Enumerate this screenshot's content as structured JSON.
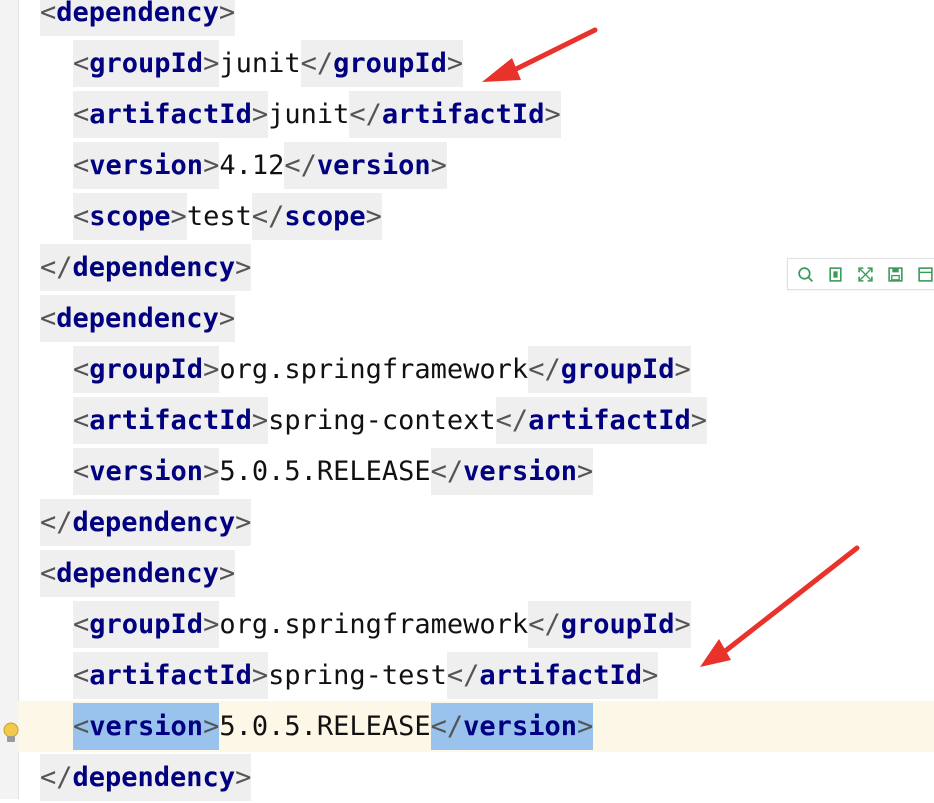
{
  "editor": {
    "lines": [
      {
        "indent": 0,
        "parts": [
          {
            "tag": "dependency",
            "kind": "open"
          }
        ]
      },
      {
        "indent": 1,
        "parts": [
          {
            "tag": "groupId",
            "kind": "open"
          },
          {
            "text": "junit"
          },
          {
            "tag": "groupId",
            "kind": "close"
          }
        ]
      },
      {
        "indent": 1,
        "parts": [
          {
            "tag": "artifactId",
            "kind": "open"
          },
          {
            "text": "junit"
          },
          {
            "tag": "artifactId",
            "kind": "close"
          }
        ]
      },
      {
        "indent": 1,
        "parts": [
          {
            "tag": "version",
            "kind": "open"
          },
          {
            "text": "4.12"
          },
          {
            "tag": "version",
            "kind": "close"
          }
        ]
      },
      {
        "indent": 1,
        "parts": [
          {
            "tag": "scope",
            "kind": "open"
          },
          {
            "text": "test"
          },
          {
            "tag": "scope",
            "kind": "close"
          }
        ]
      },
      {
        "indent": 0,
        "parts": [
          {
            "tag": "dependency",
            "kind": "close"
          }
        ]
      },
      {
        "indent": 0,
        "parts": [
          {
            "tag": "dependency",
            "kind": "open"
          }
        ]
      },
      {
        "indent": 1,
        "parts": [
          {
            "tag": "groupId",
            "kind": "open"
          },
          {
            "text": "org.springframework"
          },
          {
            "tag": "groupId",
            "kind": "close"
          }
        ]
      },
      {
        "indent": 1,
        "parts": [
          {
            "tag": "artifactId",
            "kind": "open"
          },
          {
            "text": "spring-context"
          },
          {
            "tag": "artifactId",
            "kind": "close"
          }
        ]
      },
      {
        "indent": 1,
        "parts": [
          {
            "tag": "version",
            "kind": "open"
          },
          {
            "text": "5.0.5.RELEASE"
          },
          {
            "tag": "version",
            "kind": "close"
          }
        ]
      },
      {
        "indent": 0,
        "parts": [
          {
            "tag": "dependency",
            "kind": "close"
          }
        ]
      },
      {
        "indent": 0,
        "parts": [
          {
            "tag": "dependency",
            "kind": "open"
          }
        ]
      },
      {
        "indent": 1,
        "parts": [
          {
            "tag": "groupId",
            "kind": "open"
          },
          {
            "text": "org.springframework"
          },
          {
            "tag": "groupId",
            "kind": "close"
          }
        ]
      },
      {
        "indent": 1,
        "parts": [
          {
            "tag": "artifactId",
            "kind": "open"
          },
          {
            "text": "spring-test"
          },
          {
            "tag": "artifactId",
            "kind": "close"
          }
        ]
      },
      {
        "indent": 1,
        "caret": true,
        "parts": [
          {
            "tag": "version",
            "kind": "open"
          },
          {
            "text": "5.0.5.RELEASE"
          },
          {
            "tag": "version",
            "kind": "close"
          }
        ]
      },
      {
        "indent": 0,
        "parts": [
          {
            "tag": "dependency",
            "kind": "close"
          }
        ]
      }
    ]
  },
  "toolbar": {
    "buttons": [
      {
        "icon": "search-icon"
      },
      {
        "icon": "copy-icon"
      },
      {
        "icon": "expand-icon"
      },
      {
        "icon": "save-icon"
      },
      {
        "icon": "panel-icon"
      }
    ]
  },
  "annotations": [
    {
      "icon": "red-arrow-icon",
      "color": "#e8322a"
    },
    {
      "icon": "red-arrow-icon",
      "color": "#e8322a"
    }
  ],
  "colors": {
    "tag_name": "#000080",
    "tag_bg": "#efefef",
    "highlight_bg": "#99c2ec",
    "caret_line_bg": "#fcf7e6",
    "arrow": "#e8322a"
  }
}
